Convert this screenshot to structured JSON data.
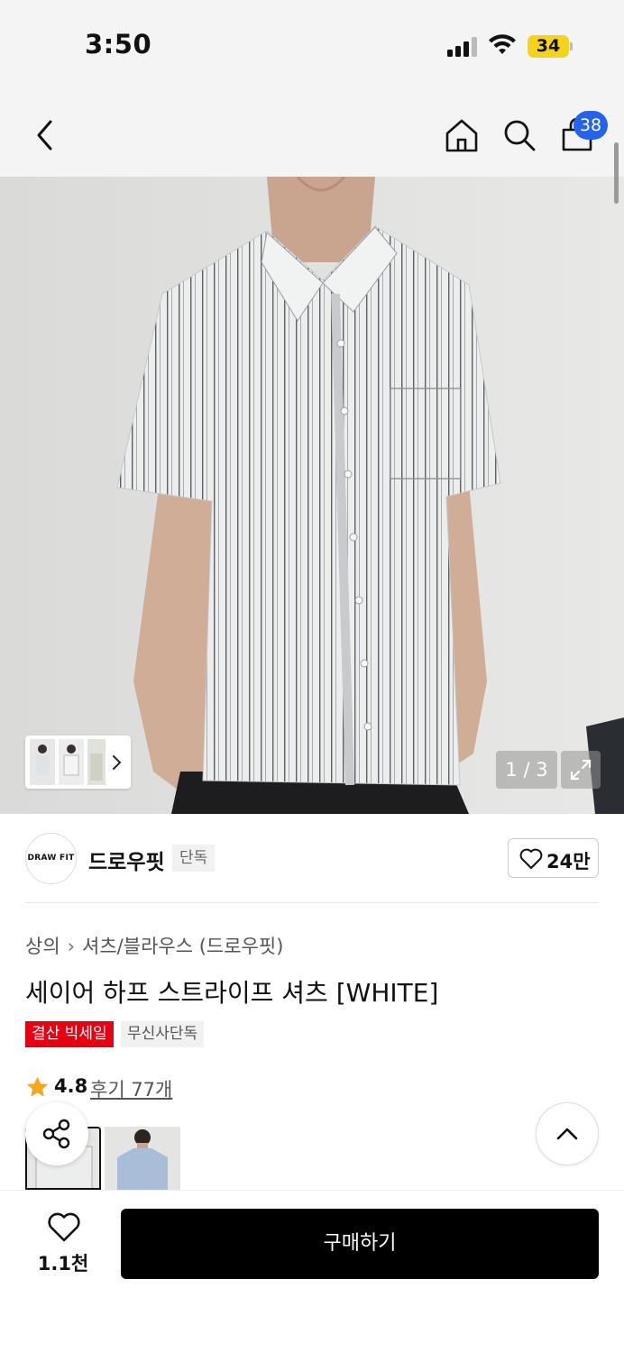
{
  "status_bar": {
    "time": "3:50",
    "battery": "34",
    "battery_color": "#f5d21c",
    "icons": [
      "cellular-signal-icon",
      "wifi-icon",
      "battery-icon"
    ]
  },
  "nav": {
    "icons": [
      "back-arrow-icon",
      "home-icon",
      "search-icon",
      "shopping-bag-icon"
    ],
    "cart_badge": "38",
    "cart_badge_color": "#2463eb"
  },
  "gallery": {
    "counter": "1 / 3",
    "thumbnail_strip_icon": "chevron-right-icon",
    "expand_icon": "expand-icon"
  },
  "brand": {
    "logo_text": "DRAW FIT",
    "name": "드로우핏",
    "exclusive_tag": "단독",
    "like_count": "24만"
  },
  "product": {
    "breadcrumb": [
      "상의",
      "셔츠/블라우스 (드로우핏)"
    ],
    "title": "세이어 하프 스트라이프 셔츠 [WHITE]",
    "badges": [
      "결산 빅세일",
      "무신사단독"
    ],
    "sale_badge_color": "#e60012",
    "rating": "4.8",
    "reviews_label": "후기 77개",
    "color_options": [
      "white-stripe",
      "blue-stripe"
    ]
  },
  "floating": {
    "share_icon": "share-icon",
    "scroll_top_icon": "chevron-up-icon"
  },
  "bottom_bar": {
    "wish_count": "1.1천",
    "buy_label": "구매하기"
  }
}
